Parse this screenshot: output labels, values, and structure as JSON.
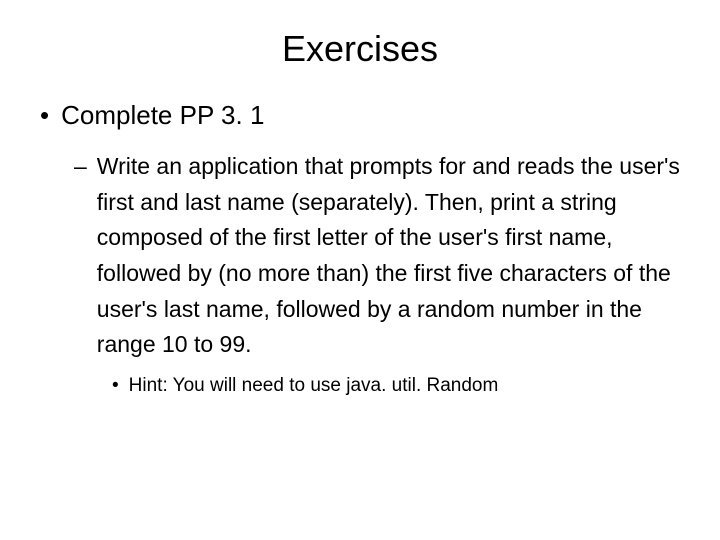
{
  "title": "Exercises",
  "bullets": {
    "l1": "Complete PP 3. 1",
    "l2": "Write an application that prompts for and reads the user's first and last name (separately). Then, print a string composed of the first letter of the user's first name, followed by (no more than) the first five characters of the user's last name, followed by a random number in the range 10 to 99.",
    "l3": "Hint: You will need to use java. util. Random"
  },
  "markers": {
    "dot": "•",
    "dash": "–"
  }
}
